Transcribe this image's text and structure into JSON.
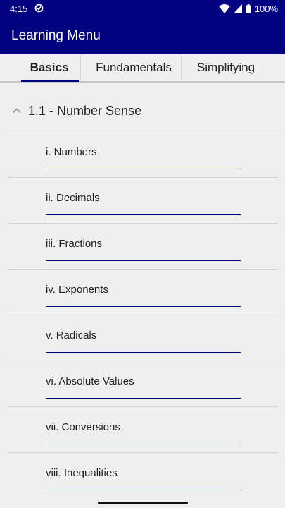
{
  "status": {
    "time": "4:15",
    "battery": "100%",
    "icons": [
      "sync-icon",
      "wifi-icon",
      "signal-icon",
      "battery-icon"
    ]
  },
  "app": {
    "title": "Learning Menu",
    "colors": {
      "primary": "#000080",
      "background": "#efefef"
    }
  },
  "tabs": [
    {
      "label": "Basics",
      "active": true
    },
    {
      "label": "Fundamentals",
      "active": false
    },
    {
      "label": "Simplifying",
      "active": false
    }
  ],
  "section": {
    "title": "1.1 - Number Sense",
    "expanded": true,
    "items": [
      {
        "label": "i. Numbers"
      },
      {
        "label": "ii. Decimals"
      },
      {
        "label": "iii. Fractions"
      },
      {
        "label": "iv. Exponents"
      },
      {
        "label": "v. Radicals"
      },
      {
        "label": "vi. Absolute Values"
      },
      {
        "label": "vii. Conversions"
      },
      {
        "label": "viii. Inequalities"
      }
    ]
  }
}
